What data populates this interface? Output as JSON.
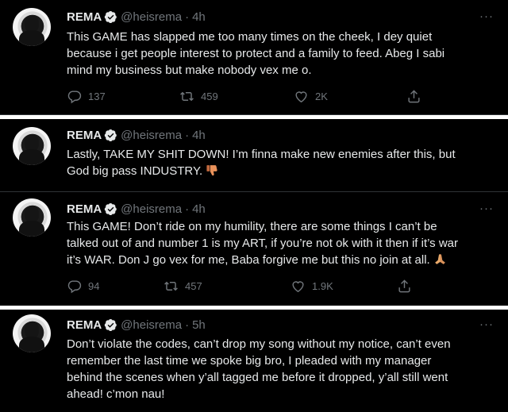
{
  "colors": {
    "background": "#000000",
    "text": "#e7e9ea",
    "muted": "#71767b",
    "verified": "#e7e9ea",
    "divider": "#2f3336"
  },
  "tweets": [
    {
      "name": "REMA",
      "handle": "@heisrema",
      "time": "4h",
      "text_lines": [
        "This GAME has slapped me too many times on the cheek, I dey quiet",
        "because i get people interest to protect and a family to feed. Abeg I sabi",
        "mind my business but make nobody vex me o."
      ],
      "replies": "137",
      "retweets": "459",
      "likes": "2K"
    },
    {
      "name": "REMA",
      "handle": "@heisrema",
      "time": "4h",
      "text_lines": [
        "Lastly, TAKE MY SHIT DOWN! I’m finna make new enemies after this, but",
        "God big pass INDUSTRY."
      ],
      "emoji": "thumbs-down-icon"
    },
    {
      "name": "REMA",
      "handle": "@heisrema",
      "time": "4h",
      "text_lines": [
        "This GAME! Don’t ride on my humility, there are some things I can’t be",
        "talked out of and number 1 is my ART, if you’re not ok with it then if it’s war",
        "it’s WAR. Don J go vex for me, Baba forgive me but this no join at all."
      ],
      "emoji": "folded-hands-icon",
      "replies": "94",
      "retweets": "457",
      "likes": "1.9K"
    },
    {
      "name": "REMA",
      "handle": "@heisrema",
      "time": "5h",
      "text_lines": [
        "Don’t violate the codes, can’t drop my song without my notice, can’t even",
        "remember the last time we spoke big bro, I pleaded with my manager",
        "behind the scenes when y’all tagged me before it dropped, y’all still went",
        "ahead! c’mon nau!"
      ]
    }
  ],
  "menu_label": "···",
  "separator": "·"
}
